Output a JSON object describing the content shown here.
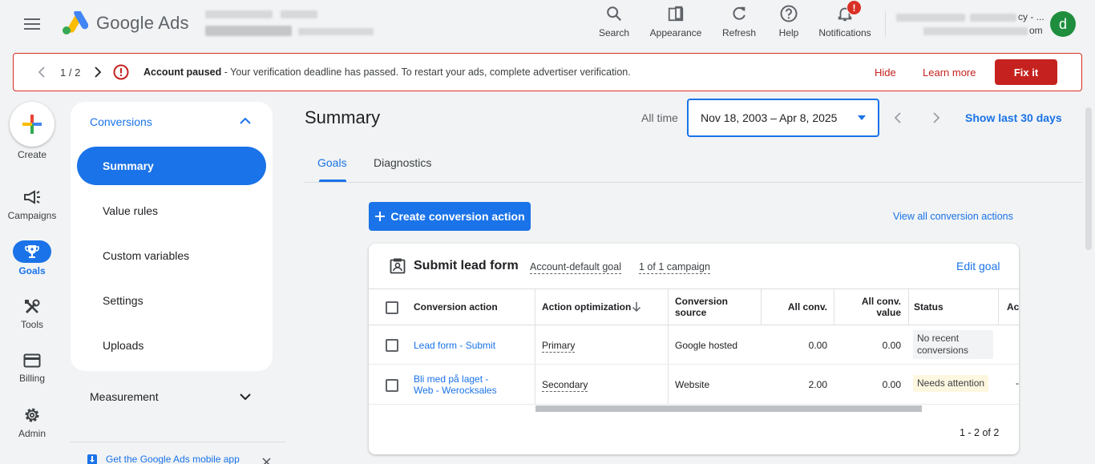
{
  "header": {
    "product_name": "Google Ads",
    "actions": [
      {
        "label": "Search",
        "icon": "search-icon"
      },
      {
        "label": "Appearance",
        "icon": "appearance-icon"
      },
      {
        "label": "Refresh",
        "icon": "refresh-icon"
      },
      {
        "label": "Help",
        "icon": "help-icon"
      },
      {
        "label": "Notifications",
        "icon": "bell-icon"
      }
    ],
    "notification_badge": "!",
    "avatar_letter": "d",
    "account_line1_suffix": "cy - ...",
    "account_line2_suffix": "om"
  },
  "banner": {
    "pagination": "1 / 2",
    "title": "Account paused",
    "message": " - Your verification deadline has passed. To restart your ads, complete advertiser verification.",
    "hide_label": "Hide",
    "learn_more_label": "Learn more",
    "fix_label": "Fix it"
  },
  "rail": {
    "create": "Create",
    "campaigns": "Campaigns",
    "goals": "Goals",
    "tools": "Tools",
    "billing": "Billing",
    "admin": "Admin"
  },
  "subnav": {
    "section": "Conversions",
    "items": [
      "Summary",
      "Value rules",
      "Custom variables",
      "Settings",
      "Uploads"
    ],
    "measurement": "Measurement",
    "mobile_app": "Get the Google Ads mobile app"
  },
  "main": {
    "title": "Summary",
    "date_preset": "All time",
    "date_range": "Nov 18, 2003 – Apr 8, 2025",
    "show_last": "Show last 30 days",
    "tabs": [
      "Goals",
      "Diagnostics"
    ],
    "create_action": "Create conversion action",
    "view_all": "View all conversion actions"
  },
  "card": {
    "goal_title": "Submit lead form",
    "goal_tag": "Account-default goal",
    "campaign_tag": "1 of 1 campaign",
    "edit_goal": "Edit goal",
    "columns": {
      "action": "Conversion action",
      "optimization": "Action optimization",
      "source_1": "Conversion",
      "source_2": "source",
      "all_conv": "All conv.",
      "all_value_1": "All conv.",
      "all_value_2": "value",
      "status": "Status",
      "extra": "Ac"
    },
    "rows": [
      {
        "action": "Lead form - Submit",
        "action_2": "",
        "optimization": "Primary",
        "source": "Google hosted",
        "all_conv": "0.00",
        "value": "0.00",
        "status_1": "No recent",
        "status_2": "conversions"
      },
      {
        "action": "Bli med på laget -",
        "action_2": "Web - Werocksales",
        "optimization": "Secondary",
        "source": "Website",
        "all_conv": "2.00",
        "value": "0.00",
        "status_1": "Needs attention",
        "status_2": ""
      }
    ],
    "row2_extra": "-",
    "pager": "1 - 2 of 2"
  }
}
